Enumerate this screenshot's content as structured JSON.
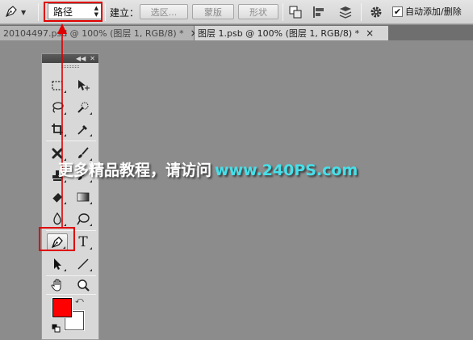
{
  "options_bar": {
    "mode_value": "路径",
    "make_label": "建立：",
    "selection_button": "选区...",
    "mask_button": "蒙版",
    "shape_button": "形状",
    "auto_add_delete_label": "自动添加/删除",
    "auto_add_delete_checked": true,
    "icons": [
      "pen-tool-icon",
      "path-operations-icon",
      "path-alignment-icon",
      "path-arrangement-icon",
      "gear-icon"
    ]
  },
  "tabs": [
    {
      "label": "20104497.psd @ 100% (图层 1, RGB/8) *",
      "active": false
    },
    {
      "label": "图层 1.psb @ 100% (图层 1, RGB/8) *",
      "active": true
    }
  ],
  "tool_close": "×",
  "toolbox": {
    "tools": [
      "rectangular-marquee",
      "move",
      "lasso",
      "quick-selection",
      "crop",
      "eyedropper",
      "spot-healing",
      "brush",
      "clone-stamp",
      "history-brush",
      "eraser",
      "gradient",
      "blur",
      "dodge",
      "pen",
      "type",
      "path-selection",
      "line",
      "hand",
      "zoom"
    ],
    "selected_tool": "pen",
    "type_tool_glyph": "T",
    "foreground_color": "#ff0000",
    "background_color": "#ffffff"
  },
  "watermark": {
    "text_cn": "更多精品教程，请访问",
    "text_url": "www.240PS.com"
  },
  "colors": {
    "canvas_bg": "#8c8c8c",
    "highlight": "#e00000",
    "watermark_url": "#46e0ea"
  }
}
